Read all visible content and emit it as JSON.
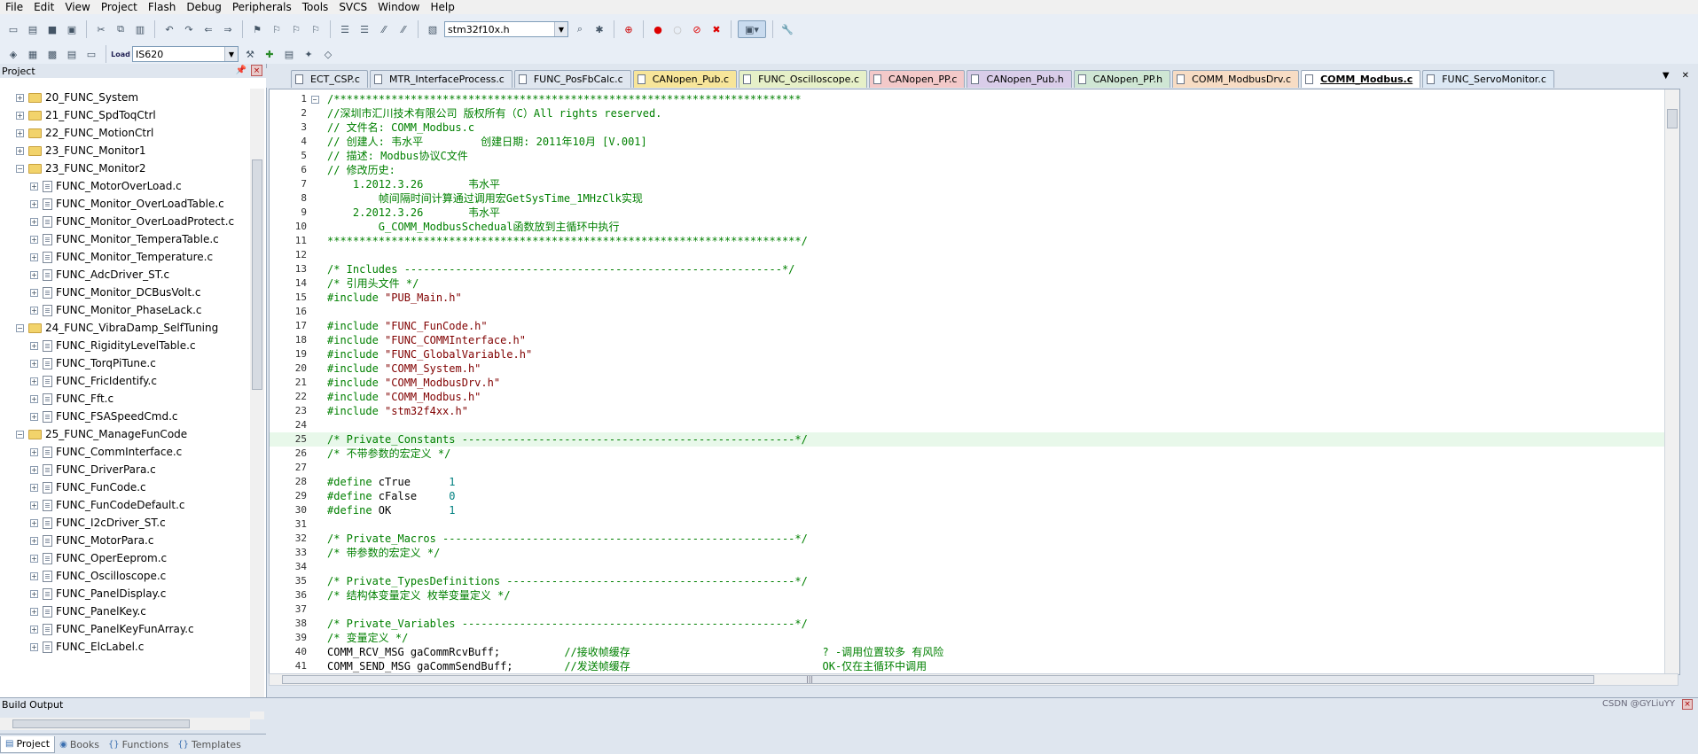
{
  "menu": [
    "File",
    "Edit",
    "View",
    "Project",
    "Flash",
    "Debug",
    "Peripherals",
    "Tools",
    "SVCS",
    "Window",
    "Help"
  ],
  "toolbar": {
    "file_combo": "stm32f10x.h",
    "target_combo": "IS620",
    "load_label": "Load"
  },
  "project_panel": {
    "title": "Project",
    "pin_icon": "pin-icon",
    "close_label": "×",
    "tree": [
      {
        "label": "20_FUNC_System",
        "type": "folder",
        "level": 1,
        "expanded": false
      },
      {
        "label": "21_FUNC_SpdToqCtrl",
        "type": "folder",
        "level": 1,
        "expanded": false
      },
      {
        "label": "22_FUNC_MotionCtrl",
        "type": "folder",
        "level": 1,
        "expanded": false
      },
      {
        "label": "23_FUNC_Monitor1",
        "type": "folder",
        "level": 1,
        "expanded": false
      },
      {
        "label": "23_FUNC_Monitor2",
        "type": "folder",
        "level": 1,
        "expanded": true
      },
      {
        "label": "FUNC_MotorOverLoad.c",
        "type": "file",
        "level": 2
      },
      {
        "label": "FUNC_Monitor_OverLoadTable.c",
        "type": "file",
        "level": 2
      },
      {
        "label": "FUNC_Monitor_OverLoadProtect.c",
        "type": "file",
        "level": 2
      },
      {
        "label": "FUNC_Monitor_TemperaTable.c",
        "type": "file",
        "level": 2
      },
      {
        "label": "FUNC_Monitor_Temperature.c",
        "type": "file",
        "level": 2
      },
      {
        "label": "FUNC_AdcDriver_ST.c",
        "type": "file",
        "level": 2
      },
      {
        "label": "FUNC_Monitor_DCBusVolt.c",
        "type": "file",
        "level": 2
      },
      {
        "label": "FUNC_Monitor_PhaseLack.c",
        "type": "file",
        "level": 2
      },
      {
        "label": "24_FUNC_VibraDamp_SelfTuning",
        "type": "folder",
        "level": 1,
        "expanded": true
      },
      {
        "label": "FUNC_RigidityLevelTable.c",
        "type": "file",
        "level": 2
      },
      {
        "label": "FUNC_TorqPiTune.c",
        "type": "file",
        "level": 2
      },
      {
        "label": "FUNC_FricIdentify.c",
        "type": "file",
        "level": 2
      },
      {
        "label": "FUNC_Fft.c",
        "type": "file",
        "level": 2
      },
      {
        "label": "FUNC_FSASpeedCmd.c",
        "type": "file",
        "level": 2
      },
      {
        "label": "25_FUNC_ManageFunCode",
        "type": "folder",
        "level": 1,
        "expanded": true
      },
      {
        "label": "FUNC_CommInterface.c",
        "type": "file",
        "level": 2
      },
      {
        "label": "FUNC_DriverPara.c",
        "type": "file",
        "level": 2
      },
      {
        "label": "FUNC_FunCode.c",
        "type": "file",
        "level": 2
      },
      {
        "label": "FUNC_FunCodeDefault.c",
        "type": "file",
        "level": 2
      },
      {
        "label": "FUNC_I2cDriver_ST.c",
        "type": "file",
        "level": 2
      },
      {
        "label": "FUNC_MotorPara.c",
        "type": "file",
        "level": 2
      },
      {
        "label": "FUNC_OperEeprom.c",
        "type": "file",
        "level": 2
      },
      {
        "label": "FUNC_Oscilloscope.c",
        "type": "file",
        "level": 2
      },
      {
        "label": "FUNC_PanelDisplay.c",
        "type": "file",
        "level": 2
      },
      {
        "label": "FUNC_PanelKey.c",
        "type": "file",
        "level": 2
      },
      {
        "label": "FUNC_PanelKeyFunArray.c",
        "type": "file",
        "level": 2
      },
      {
        "label": "FUNC_ElcLabel.c",
        "type": "file",
        "level": 2
      }
    ],
    "tabs": [
      {
        "label": "Project",
        "icon": "project-icon",
        "active": true
      },
      {
        "label": "Books",
        "icon": "books-icon",
        "active": false
      },
      {
        "label": "Functions",
        "icon": "functions-icon",
        "active": false
      },
      {
        "label": "Templates",
        "icon": "templates-icon",
        "active": false
      }
    ]
  },
  "editor_tabs": [
    {
      "label": "ECT_CSP.c",
      "color": "#dfe6ef",
      "active": false
    },
    {
      "label": "MTR_InterfaceProcess.c",
      "color": "#dfe6ef",
      "active": false
    },
    {
      "label": "FUNC_PosFbCalc.c",
      "color": "#dfe6ef",
      "active": false
    },
    {
      "label": "CANopen_Pub.c",
      "color": "#f7e59a",
      "active": false
    },
    {
      "label": "FUNC_Oscilloscope.c",
      "color": "#e6f0c8",
      "active": false
    },
    {
      "label": "CANopen_PP.c",
      "color": "#f3c9c9",
      "active": false
    },
    {
      "label": "CANopen_Pub.h",
      "color": "#d9cde9",
      "active": false
    },
    {
      "label": "CANopen_PP.h",
      "color": "#cfe6d4",
      "active": false
    },
    {
      "label": "COMM_ModbusDrv.c",
      "color": "#f7dcc4",
      "active": false
    },
    {
      "label": "COMM_Modbus.c",
      "color": "#f6d6e6",
      "active": true
    },
    {
      "label": "FUNC_ServoMonitor.c",
      "color": "#dce8f4",
      "active": false
    }
  ],
  "tab_controls": [
    "▼",
    "✕"
  ],
  "code_lines": [
    {
      "n": "1",
      "fold": "−",
      "hl": false,
      "segs": [
        {
          "c": "cm",
          "t": "/*************************************************************************"
        }
      ]
    },
    {
      "n": "2",
      "segs": [
        {
          "c": "cm",
          "t": "//深圳市汇川技术有限公司 版权所有（C）All rights reserved."
        }
      ]
    },
    {
      "n": "3",
      "segs": [
        {
          "c": "cm",
          "t": "// 文件名: COMM_Modbus.c"
        }
      ]
    },
    {
      "n": "4",
      "segs": [
        {
          "c": "cm",
          "t": "// 创建人: 韦水平         创建日期: 2011年10月 [V.001]"
        }
      ]
    },
    {
      "n": "5",
      "segs": [
        {
          "c": "cm",
          "t": "// 描述: Modbus协议C文件"
        }
      ]
    },
    {
      "n": "6",
      "segs": [
        {
          "c": "cm",
          "t": "// 修改历史:"
        }
      ]
    },
    {
      "n": "7",
      "segs": [
        {
          "c": "cm",
          "t": "    1.2012.3.26       韦水平"
        }
      ]
    },
    {
      "n": "8",
      "segs": [
        {
          "c": "cm",
          "t": "        帧间隔时间计算通过调用宏GetSysTime_1MHzClk实现"
        }
      ]
    },
    {
      "n": "9",
      "segs": [
        {
          "c": "cm",
          "t": "    2.2012.3.26       韦水平"
        }
      ]
    },
    {
      "n": "10",
      "segs": [
        {
          "c": "cm",
          "t": "        G_COMM_ModbusSchedual函数放到主循环中执行"
        }
      ]
    },
    {
      "n": "11",
      "segs": [
        {
          "c": "cm",
          "t": "**************************************************************************/"
        }
      ]
    },
    {
      "n": "12",
      "segs": []
    },
    {
      "n": "13",
      "segs": [
        {
          "c": "cm",
          "t": "/* Includes -----------------------------------------------------------*/"
        }
      ]
    },
    {
      "n": "14",
      "segs": [
        {
          "c": "cm",
          "t": "/* 引用头文件 */"
        }
      ]
    },
    {
      "n": "15",
      "segs": [
        {
          "c": "pp",
          "t": "#include "
        },
        {
          "c": "str",
          "t": "\"PUB_Main.h\""
        }
      ]
    },
    {
      "n": "16",
      "segs": []
    },
    {
      "n": "17",
      "segs": [
        {
          "c": "pp",
          "t": "#include "
        },
        {
          "c": "str",
          "t": "\"FUNC_FunCode.h\""
        }
      ]
    },
    {
      "n": "18",
      "segs": [
        {
          "c": "pp",
          "t": "#include "
        },
        {
          "c": "str",
          "t": "\"FUNC_COMMInterface.h\""
        }
      ]
    },
    {
      "n": "19",
      "segs": [
        {
          "c": "pp",
          "t": "#include "
        },
        {
          "c": "str",
          "t": "\"FUNC_GlobalVariable.h\""
        }
      ]
    },
    {
      "n": "20",
      "segs": [
        {
          "c": "pp",
          "t": "#include "
        },
        {
          "c": "str",
          "t": "\"COMM_System.h\""
        }
      ]
    },
    {
      "n": "21",
      "segs": [
        {
          "c": "pp",
          "t": "#include "
        },
        {
          "c": "str",
          "t": "\"COMM_ModbusDrv.h\""
        }
      ]
    },
    {
      "n": "22",
      "segs": [
        {
          "c": "pp",
          "t": "#include "
        },
        {
          "c": "str",
          "t": "\"COMM_Modbus.h\""
        }
      ]
    },
    {
      "n": "23",
      "segs": [
        {
          "c": "pp",
          "t": "#include "
        },
        {
          "c": "str",
          "t": "\"stm32f4xx.h\""
        }
      ]
    },
    {
      "n": "24",
      "segs": []
    },
    {
      "n": "25",
      "hl": true,
      "segs": [
        {
          "c": "cm",
          "t": "/* Private_Constants ----------------------------------------------------*/"
        }
      ]
    },
    {
      "n": "26",
      "segs": [
        {
          "c": "cm",
          "t": "/* 不带参数的宏定义 */"
        }
      ]
    },
    {
      "n": "27",
      "segs": []
    },
    {
      "n": "28",
      "segs": [
        {
          "c": "pp",
          "t": "#define "
        },
        {
          "c": "",
          "t": "cTrue      "
        },
        {
          "c": "num",
          "t": "1"
        }
      ]
    },
    {
      "n": "29",
      "segs": [
        {
          "c": "pp",
          "t": "#define "
        },
        {
          "c": "",
          "t": "cFalse     "
        },
        {
          "c": "num",
          "t": "0"
        }
      ]
    },
    {
      "n": "30",
      "segs": [
        {
          "c": "pp",
          "t": "#define "
        },
        {
          "c": "",
          "t": "OK         "
        },
        {
          "c": "num",
          "t": "1"
        }
      ]
    },
    {
      "n": "31",
      "segs": []
    },
    {
      "n": "32",
      "segs": [
        {
          "c": "cm",
          "t": "/* Private_Macros -------------------------------------------------------*/"
        }
      ]
    },
    {
      "n": "33",
      "segs": [
        {
          "c": "cm",
          "t": "/* 带参数的宏定义 */"
        }
      ]
    },
    {
      "n": "34",
      "segs": []
    },
    {
      "n": "35",
      "segs": [
        {
          "c": "cm",
          "t": "/* Private_TypesDefinitions ---------------------------------------------*/"
        }
      ]
    },
    {
      "n": "36",
      "segs": [
        {
          "c": "cm",
          "t": "/* 结构体变量定义 枚举变量定义 */"
        }
      ]
    },
    {
      "n": "37",
      "segs": []
    },
    {
      "n": "38",
      "segs": [
        {
          "c": "cm",
          "t": "/* Private_Variables ----------------------------------------------------*/"
        }
      ]
    },
    {
      "n": "39",
      "segs": [
        {
          "c": "cm",
          "t": "/* 变量定义 */"
        }
      ]
    },
    {
      "n": "40",
      "segs": [
        {
          "c": "",
          "t": "COMM_RCV_MSG gaCommRcvBuff;          "
        },
        {
          "c": "cm",
          "t": "//接收帧缓存                              ? -调用位置较多 有风险"
        }
      ]
    },
    {
      "n": "41",
      "segs": [
        {
          "c": "",
          "t": "COMM_SEND_MSG gaCommSendBuff;        "
        },
        {
          "c": "cm",
          "t": "//发送帧缓存                              OK-仅在主循环中调用"
        }
      ]
    }
  ],
  "build_output": {
    "title": "Build Output",
    "watermark": "CSDN @GYLiuYY",
    "close_label": "×"
  }
}
